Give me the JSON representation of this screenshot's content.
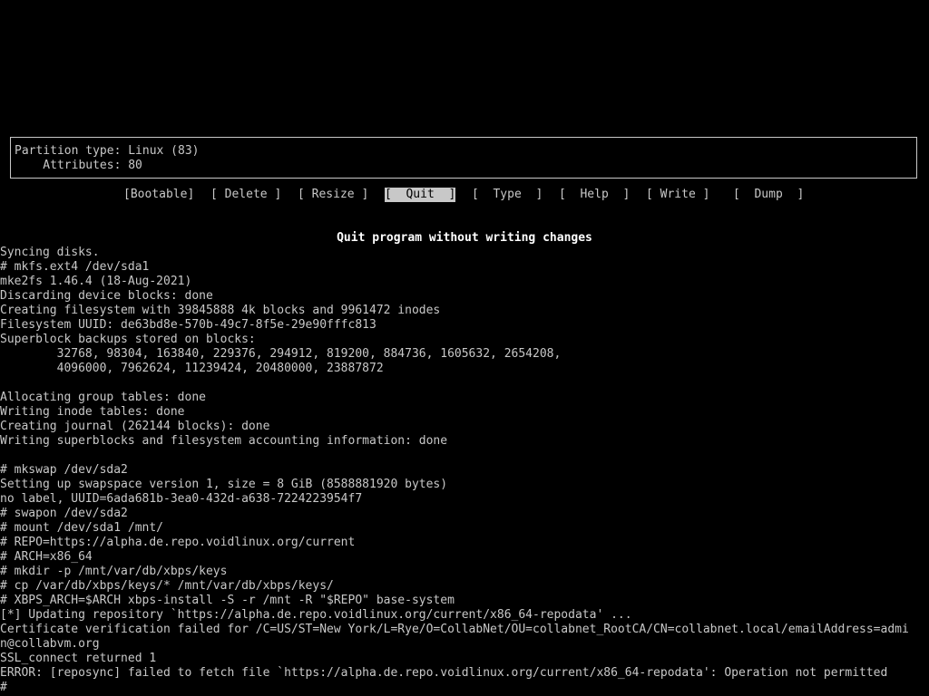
{
  "partition_info": {
    "type_line": "Partition type: Linux (83)",
    "attributes_line": "    Attributes: 80"
  },
  "menu": {
    "items": [
      {
        "label": "[Bootable]",
        "selected": false
      },
      {
        "label": "[ Delete ]",
        "selected": false
      },
      {
        "label": "[ Resize ]",
        "selected": false
      },
      {
        "label": "[  Quit  ]",
        "selected": true
      },
      {
        "label": "[  Type  ]",
        "selected": false
      },
      {
        "label": "[  Help  ]",
        "selected": false
      },
      {
        "label": "[ Write ]",
        "selected": false
      },
      {
        "label": "[  Dump  ]",
        "selected": false
      }
    ]
  },
  "hint": "Quit program without writing changes",
  "terminal_log": [
    "Syncing disks.",
    "# mkfs.ext4 /dev/sda1",
    "mke2fs 1.46.4 (18-Aug-2021)",
    "Discarding device blocks: done",
    "Creating filesystem with 39845888 4k blocks and 9961472 inodes",
    "Filesystem UUID: de63bd8e-570b-49c7-8f5e-29e90fffc813",
    "Superblock backups stored on blocks:",
    "        32768, 98304, 163840, 229376, 294912, 819200, 884736, 1605632, 2654208,",
    "        4096000, 7962624, 11239424, 20480000, 23887872",
    "",
    "Allocating group tables: done",
    "Writing inode tables: done",
    "Creating journal (262144 blocks): done",
    "Writing superblocks and filesystem accounting information: done",
    "",
    "# mkswap /dev/sda2",
    "Setting up swapspace version 1, size = 8 GiB (8588881920 bytes)",
    "no label, UUID=6ada681b-3ea0-432d-a638-7224223954f7",
    "# swapon /dev/sda2",
    "# mount /dev/sda1 /mnt/",
    "# REPO=https://alpha.de.repo.voidlinux.org/current",
    "# ARCH=x86_64",
    "# mkdir -p /mnt/var/db/xbps/keys",
    "# cp /var/db/xbps/keys/* /mnt/var/db/xbps/keys/",
    "# XBPS_ARCH=$ARCH xbps-install -S -r /mnt -R \"$REPO\" base-system",
    "[*] Updating repository `https://alpha.de.repo.voidlinux.org/current/x86_64-repodata' ...",
    "Certificate verification failed for /C=US/ST=New York/L=Rye/O=CollabNet/OU=collabnet_RootCA/CN=collabnet.local/emailAddress=admi",
    "n@collabvm.org",
    "SSL_connect returned 1",
    "ERROR: [reposync] failed to fetch file `https://alpha.de.repo.voidlinux.org/current/x86_64-repodata': Operation not permitted",
    "#"
  ]
}
